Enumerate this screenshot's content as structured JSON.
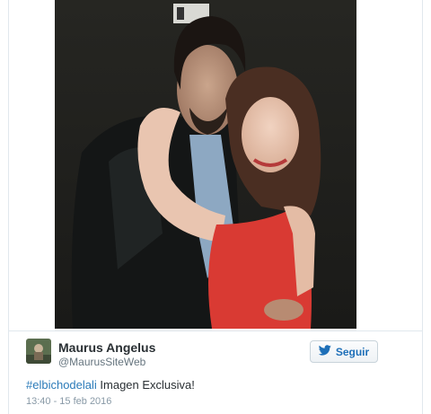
{
  "tweet": {
    "author": {
      "display_name": "Maurus Angelus",
      "handle": "@MaurusSiteWeb"
    },
    "follow_button": {
      "label": "Seguir",
      "icon": "twitter-bird-icon",
      "accent_color": "#1d6fb8"
    },
    "text": {
      "hashtag": "#elbichodelali",
      "body": " Imagen Exclusiva!"
    },
    "timestamp": "13:40 - 15 feb 2016",
    "photo": {
      "description_icon": "photo-two-people-embracing"
    }
  },
  "colors": {
    "link": "#2b7bb9",
    "name": "#292f33",
    "muted": "#66757f",
    "timestamp": "#8899a6",
    "border": "#e1e8ed"
  }
}
